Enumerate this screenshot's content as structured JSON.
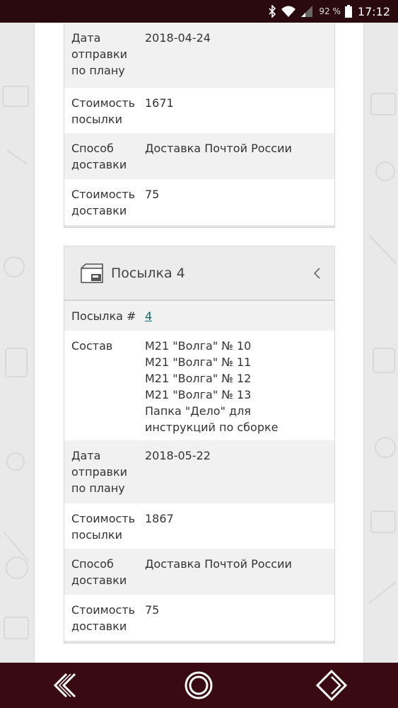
{
  "status_bar": {
    "battery_percent": "92 %",
    "time": "17:12",
    "icons": [
      "bluetooth-icon",
      "wifi-icon",
      "signal-icon",
      "battery-icon"
    ]
  },
  "parcel3_tail": {
    "rows": [
      {
        "key": "Дата отправки по плану",
        "key_lines": [
          "Дата",
          "отправки",
          "по плану"
        ],
        "value": "2018-04-24"
      },
      {
        "key": "Стоимость посылки",
        "key_lines": [
          "Стоимость",
          "посылки"
        ],
        "value": "1671"
      },
      {
        "key": "Способ доставки",
        "key_lines": [
          "Способ",
          "доставки"
        ],
        "value": "Доставка Почтой России"
      },
      {
        "key": "Стоимость доставки",
        "key_lines": [
          "Стоимость",
          "доставки"
        ],
        "value": "75"
      }
    ]
  },
  "parcel4": {
    "title": "Посылка 4",
    "number_label": "Посылка #",
    "number_value": "4",
    "composition_label": "Состав",
    "composition_lines": [
      "М21 \"Волга\" № 10",
      "М21 \"Волга\" № 11",
      "М21 \"Волга\" № 12",
      "М21 \"Волга\" № 13",
      "Папка \"Дело\" для",
      "инструкций по сборке"
    ],
    "ship_date_label_lines": [
      "Дата",
      "отправки",
      "по плану"
    ],
    "ship_date_value": "2018-05-22",
    "parcel_cost_label_lines": [
      "Стоимость",
      "посылки"
    ],
    "parcel_cost_value": "1867",
    "delivery_method_label_lines": [
      "Способ",
      "доставки"
    ],
    "delivery_method_value": "Доставка Почтой России",
    "delivery_cost_label_lines": [
      "Стоимость",
      "доставки"
    ],
    "delivery_cost_value": "75"
  },
  "nav_bar": {
    "icons": [
      "back-double-chevron-icon",
      "home-circle-icon",
      "forward-diamond-icon"
    ]
  },
  "colors": {
    "status_bar_bg": "#2b0a0f",
    "nav_bar_bg": "#3a0a12",
    "link": "#0a6b6b",
    "row_grey": "#f1f1f1",
    "header_bg": "#ececec"
  }
}
